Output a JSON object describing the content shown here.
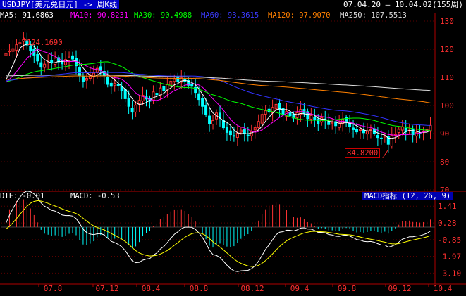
{
  "window": {
    "title": "USDJPY[美元兑日元] -> 周K线",
    "date_range": "07.04.20 — 10.04.02(155周)"
  },
  "ma_legend": [
    {
      "label": "MA5: 91.6863",
      "color": "#ffffff"
    },
    {
      "label": "MA10: 90.8231",
      "color": "#ff00ff"
    },
    {
      "label": "MA30: 90.4988",
      "color": "#00ff00"
    },
    {
      "label": "MA60: 93.3615",
      "color": "#3333ff"
    },
    {
      "label": "MA120: 97.9070",
      "color": "#ff8000"
    },
    {
      "label": "MA250: 107.5513",
      "color": "#dddddd"
    }
  ],
  "macd_legend": {
    "dif": "DIF: -0.01",
    "macd": "MACD: -0.53",
    "indicator": "MACD指标 (12, 26, 9)"
  },
  "annotations": {
    "high": "124.1690",
    "low": "84.8200"
  },
  "colors": {
    "up": "#ff3333",
    "down": "#00ffff",
    "axis": "#b00000",
    "text_axis": "#ff3030"
  },
  "chart_data": [
    {
      "type": "candlestick",
      "title": "USDJPY[美元兑日元] -> 周K线",
      "y_ticks": [
        130,
        120,
        110,
        100,
        90,
        80,
        70
      ],
      "ylim": [
        70,
        130
      ],
      "x_ticks": [
        "07.8",
        "07.12",
        "08.4",
        "08.8",
        "08.12",
        "09.4",
        "09.8",
        "09.12",
        "10.4"
      ],
      "close": [
        118.5,
        119.4,
        120.2,
        121.6,
        122.3,
        123.4,
        121.5,
        119.6,
        117.9,
        115.8,
        113.6,
        114.7,
        116.0,
        115.2,
        116.8,
        115.5,
        114.8,
        116.3,
        117.2,
        116.5,
        114.1,
        110.5,
        108.4,
        109.6,
        110.9,
        111.5,
        113.2,
        112.4,
        110.6,
        107.5,
        106.8,
        107.9,
        106.9,
        105.2,
        102.4,
        99.7,
        97.6,
        100.1,
        101.8,
        103.6,
        102.3,
        101.5,
        104.8,
        103.8,
        106.2,
        105.3,
        107.4,
        108.6,
        109.3,
        108.4,
        109.8,
        108.6,
        107.2,
        106.8,
        104.6,
        102.1,
        99.7,
        96.8,
        93.5,
        94.6,
        97.3,
        95.4,
        92.1,
        90.4,
        89.6,
        89.1,
        90.1,
        91.2,
        90.0,
        89.4,
        90.7,
        92.1,
        94.3,
        96.8,
        98.1,
        97.6,
        99.3,
        100.4,
        98.6,
        96.6,
        97.9,
        96.3,
        95.5,
        97.4,
        98.6,
        97.2,
        95.3,
        96.4,
        94.8,
        93.6,
        95.6,
        94.7,
        93.2,
        94.0,
        92.8,
        93.7,
        95.1,
        94.2,
        92.6,
        91.4,
        90.6,
        91.5,
        90.3,
        90.8,
        91.4,
        89.9,
        88.6,
        88.2,
        89.1,
        86.2,
        89.4,
        89.8,
        91.5,
        92.4,
        90.6,
        91.2,
        89.6,
        90.4,
        90.1,
        90.9,
        91.4,
        92.9
      ],
      "ma_lines": [
        {
          "name": "MA5",
          "last": 91.6863
        },
        {
          "name": "MA10",
          "last": 90.8231
        },
        {
          "name": "MA30",
          "last": 90.4988
        },
        {
          "name": "MA60",
          "last": 93.3615
        },
        {
          "name": "MA120",
          "last": 97.907
        },
        {
          "name": "MA250",
          "last": 107.5513
        }
      ],
      "high_marker": 124.169,
      "low_marker": 84.82
    },
    {
      "type": "macd",
      "title": "MACD指标 (12, 26, 9)",
      "params": [
        12,
        26,
        9
      ],
      "y_ticks": [
        1.41,
        0.28,
        -0.85,
        -1.97,
        -3.1
      ],
      "ylim": [
        -3.65,
        1.8
      ],
      "dif_last": -0.01,
      "macd_last": -0.53
    }
  ]
}
